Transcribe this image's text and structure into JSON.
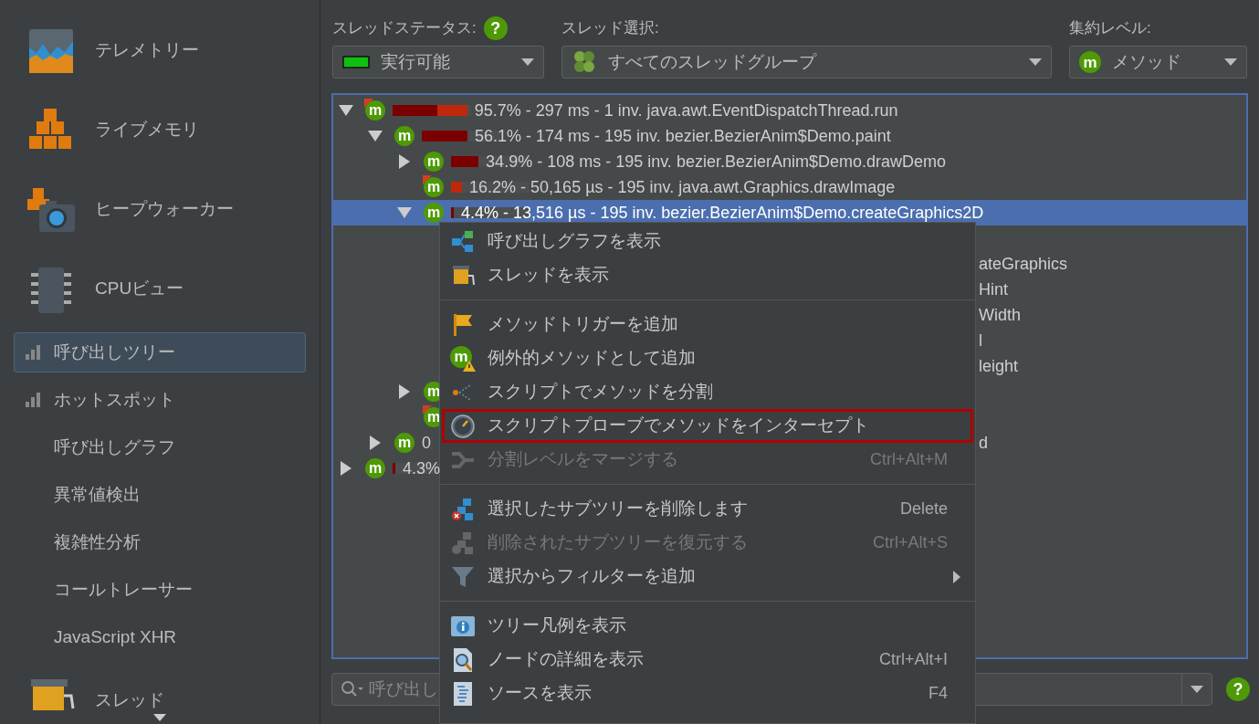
{
  "sidebar": {
    "items": [
      {
        "kind": "large",
        "label": "テレメトリー",
        "selected": false
      },
      {
        "kind": "large",
        "label": "ライブメモリ",
        "selected": false
      },
      {
        "kind": "large",
        "label": "ヒープウォーカー",
        "selected": false
      },
      {
        "kind": "large",
        "label": "CPUビュー",
        "selected": false
      },
      {
        "kind": "small",
        "has_bars": true,
        "label": "呼び出しツリー",
        "selected": true
      },
      {
        "kind": "small",
        "has_bars": true,
        "label": "ホットスポット",
        "selected": false
      },
      {
        "kind": "small",
        "has_bars": false,
        "label": "呼び出しグラフ",
        "selected": false
      },
      {
        "kind": "small",
        "has_bars": false,
        "label": "異常値検出",
        "selected": false
      },
      {
        "kind": "small",
        "has_bars": false,
        "label": "複雑性分析",
        "selected": false
      },
      {
        "kind": "small",
        "has_bars": false,
        "label": "コールトレーサー",
        "selected": false
      },
      {
        "kind": "small",
        "has_bars": false,
        "label": "JavaScript XHR",
        "selected": false
      },
      {
        "kind": "large",
        "label": "スレッド",
        "selected": false
      }
    ]
  },
  "toolbar": [
    {
      "label": "スレッドステータス:",
      "help": "?",
      "value": "実行可能"
    },
    {
      "label": "スレッド選択:",
      "value": "すべてのスレッドグループ"
    },
    {
      "label": "集約レベル:",
      "value": "メソッド",
      "badge": "m"
    }
  ],
  "tree": [
    {
      "expanded": true,
      "badge": "m",
      "flagged": true,
      "bar": [
        {
          "color": "#7a0000",
          "level": 0.57
        },
        {
          "color": "#c0280c",
          "level": 0.38
        }
      ],
      "text": "95.7% - 297 ms - 1 inv. java.awt.EventDispatchThread.run",
      "selected": false,
      "children": [
        {
          "expanded": true,
          "badge": "m",
          "flagged": false,
          "bar": [
            {
              "color": "#7a0000",
              "level": 0.58
            }
          ],
          "text": "56.1% - 174 ms - 195 inv. bezier.BezierAnim$Demo.paint",
          "selected": false,
          "children": [
            {
              "expanded": false,
              "badge": "m",
              "flagged": false,
              "bar": [
                {
                  "color": "#7a0000",
                  "level": 0.35
                }
              ],
              "text": "34.9% - 108 ms - 195 inv. bezier.BezierAnim$Demo.drawDemo",
              "selected": false
            },
            {
              "badge": "m",
              "flagged": true,
              "bar": [
                {
                  "color": "#c0280c",
                  "level": 0.14
                }
              ],
              "text": "16.2% - 50,165 µs - 195 inv. java.awt.Graphics.drawImage",
              "selected": false
            },
            {
              "expanded": true,
              "badge": "m",
              "flagged": false,
              "bar": [
                {
                  "color": "#7a0000",
                  "level": 0.035
                }
              ],
              "text": "4.4% - 13,516 µs - 195 inv. bezier.BezierAnim$Demo.createGraphics2D",
              "selected": true,
              "children": [
                {
                  "tail": "ateGraphics"
                },
                {
                  "tail": "Hint"
                },
                {
                  "tail": "Width"
                },
                {
                  "tail": "l"
                },
                {
                  "tail": "leight"
                }
              ]
            },
            {
              "expanded": false,
              "badge": "m",
              "flagged": false,
              "selected": false
            },
            {
              "badge": "m",
              "flagged": true,
              "selected": false
            }
          ]
        },
        {
          "expanded": false,
          "badge": "m",
          "flagged": false,
          "text": "0",
          "tail": "d",
          "selected": false
        }
      ]
    },
    {
      "expanded": false,
      "badge": "m",
      "flagged": false,
      "bar": [
        {
          "color": "#7a0000",
          "level": 0.035
        }
      ],
      "text": "4.3%",
      "selected": false
    }
  ],
  "context_menu": {
    "groups": [
      [
        {
          "kind": "callgraph",
          "label": "呼び出しグラフを表示",
          "disabled": false,
          "highlighted": false,
          "submenu": false
        },
        {
          "kind": "thread",
          "label": "スレッドを表示",
          "disabled": false,
          "highlighted": false,
          "submenu": false
        }
      ],
      [
        {
          "kind": "flag",
          "label": "メソッドトリガーを追加",
          "disabled": false,
          "highlighted": false,
          "submenu": false
        },
        {
          "kind": "methodwarn",
          "badge": "m",
          "label": "例外的メソッドとして追加",
          "disabled": false,
          "highlighted": false,
          "submenu": false
        },
        {
          "kind": "split",
          "label": "スクリプトでメソッドを分割",
          "disabled": false,
          "highlighted": false,
          "submenu": false
        },
        {
          "kind": "gauge",
          "label": "スクリプトプローブでメソッドをインターセプト",
          "disabled": false,
          "highlighted": true,
          "submenu": false
        },
        {
          "kind": "merge",
          "label": "分割レベルをマージする",
          "shortcut": "Ctrl+Alt+M",
          "disabled": true,
          "highlighted": false,
          "submenu": false
        }
      ],
      [
        {
          "kind": "delete",
          "label": "選択したサブツリーを削除します",
          "shortcut": "Delete",
          "disabled": false,
          "highlighted": false,
          "submenu": false
        },
        {
          "kind": "restore",
          "label": "削除されたサブツリーを復元する",
          "shortcut": "Ctrl+Alt+S",
          "disabled": true,
          "highlighted": false,
          "submenu": false
        },
        {
          "kind": "filter",
          "label": "選択からフィルターを追加",
          "submenu": true,
          "disabled": false,
          "highlighted": false
        }
      ],
      [
        {
          "kind": "info",
          "label": "ツリー凡例を表示",
          "disabled": false,
          "highlighted": false,
          "submenu": false
        },
        {
          "kind": "inspect",
          "label": "ノードの詳細を表示",
          "shortcut": "Ctrl+Alt+I",
          "disabled": false,
          "highlighted": false,
          "submenu": false
        },
        {
          "kind": "source",
          "label": "ソースを表示",
          "shortcut": "F4",
          "disabled": false,
          "highlighted": false,
          "submenu": false
        }
      ]
    ]
  },
  "search": {
    "placeholder": "呼び出し"
  },
  "footer_help": "?"
}
